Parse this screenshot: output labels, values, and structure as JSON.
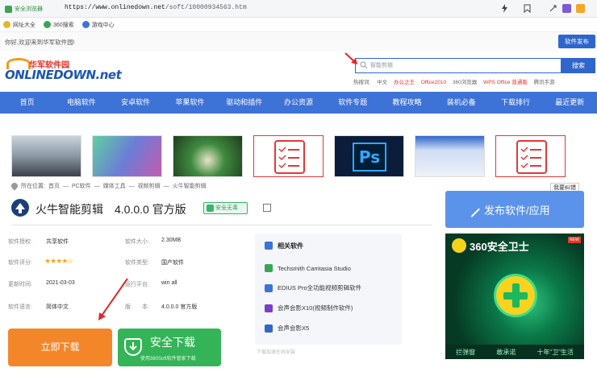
{
  "browser": {
    "secure_label": "安全浏览器",
    "url_host": "https://www.onlinedown.net",
    "url_path": "/soft/10000934563.htm"
  },
  "bookmarks": [
    {
      "label": "网址大全",
      "color": "#e8b52a"
    },
    {
      "label": "360搜索",
      "color": "#3aa655"
    },
    {
      "label": "游戏中心",
      "color": "#3d72d6"
    }
  ],
  "top": {
    "welcome": "你好,欢迎来到华军软件园!",
    "publish_btn": "软件发布"
  },
  "logo": {
    "cn": "华军软件园",
    "en": "ONLINEDOWN.net"
  },
  "search": {
    "placeholder": "智能剪辑",
    "button": "搜索",
    "hot_label": "热搜词:",
    "hot_words": [
      "中文",
      "办公之王",
      "Office2010",
      "360浏览器",
      "WPS Office 普通版",
      "腾讯手游"
    ]
  },
  "nav": {
    "items": [
      "首页",
      "电脑软件",
      "安卓软件",
      "苹果软件",
      "驱动和插件",
      "办公资源",
      "软件专题",
      "教程攻略",
      "装机必备",
      "下载排行",
      "最近更新"
    ]
  },
  "breadcrumb": {
    "label": "所在位置:",
    "items": [
      "首页",
      "PC软件",
      "媒体工具",
      "视频剪辑",
      "火牛智能剪辑"
    ]
  },
  "report": "我要纠错",
  "software": {
    "title": "火牛智能剪辑　4.0.0.0 官方版",
    "safe": "安全无毒",
    "info": [
      {
        "label": "软件授权:",
        "value": "共享软件"
      },
      {
        "label": "软件大小:",
        "value": "2.30MB"
      },
      {
        "label": "软件评分:",
        "value": "★★★★☆"
      },
      {
        "label": "软件类型:",
        "value": "国产软件"
      },
      {
        "label": "更新时间:",
        "value": "2021-03-03"
      },
      {
        "label": "运行平台:",
        "value": "win all"
      },
      {
        "label": "软件语言:",
        "value": "简体中文"
      },
      {
        "label": "版　　本:",
        "value": "4.0.0.0 官方版"
      }
    ]
  },
  "related": {
    "title": "相关软件",
    "items": [
      {
        "label": "Techsmith Camtasia Studio",
        "color": "#3aa655"
      },
      {
        "label": "EDIUS Pro全功能视频剪辑软件",
        "color": "#3d72d6"
      },
      {
        "label": "会声会影X10(视频制作软件)",
        "color": "#7a3fc9"
      },
      {
        "label": "会声会影X5",
        "color": "#2f66cc"
      }
    ],
    "hint": "下载加速在线安装"
  },
  "download": {
    "main": "立即下载",
    "safe_main": "安全下载",
    "safe_sub": "使用360Soft软件管家下载"
  },
  "publish_card": "发布软件/应用",
  "ad": {
    "title": "360安全卫士",
    "new_tag": "NEW",
    "footer": [
      "拦弹窗",
      "敢承诺",
      "十年“卫”生活"
    ]
  }
}
